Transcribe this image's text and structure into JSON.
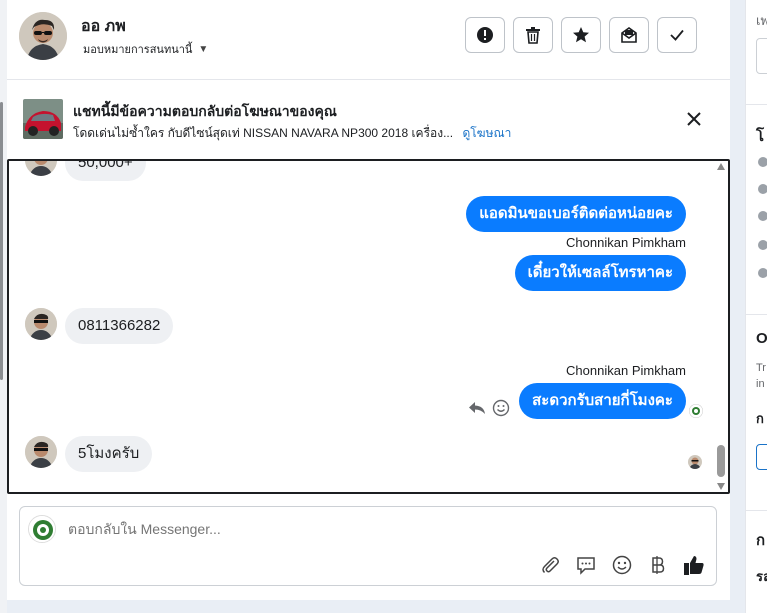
{
  "header": {
    "user_name": "ออ ภพ",
    "assign_label": "มอบหมายการสนทนานี้",
    "actions": [
      {
        "name": "mark-spam-button",
        "icon": "exclamation-circle-icon"
      },
      {
        "name": "delete-button",
        "icon": "trash-icon"
      },
      {
        "name": "star-button",
        "icon": "star-icon"
      },
      {
        "name": "mark-unread-button",
        "icon": "envelope-icon"
      },
      {
        "name": "mark-done-button",
        "icon": "check-icon"
      }
    ]
  },
  "ad_banner": {
    "title": "แชทนี้มีข้อความตอบกลับต่อโฆษณาของคุณ",
    "subtitle": "โดดเด่นไม่ซ้ำใคร กับดีไซน์สุดเท่ NISSAN NAVARA NP300 2018 เครื่อง...",
    "link": "ดูโฆษณา"
  },
  "messages": [
    {
      "direction": "in",
      "text": "50,000+"
    },
    {
      "direction": "out",
      "text": "แอดมินขอเบอร์ติดต่อหน่อยคะ"
    },
    {
      "direction": "out",
      "sender": "Chonnikan Pimkham",
      "text": "เดี๋ยวให้เซลล์โทรหาคะ"
    },
    {
      "direction": "in",
      "text": "0811366282"
    },
    {
      "direction": "out",
      "sender": "Chonnikan Pimkham",
      "text": "สะดวกรับสายกี่โมงคะ"
    },
    {
      "direction": "in",
      "text": "5โมงครับ"
    }
  ],
  "composer": {
    "placeholder": "ตอบกลับใน Messenger...",
    "tools": [
      "paperclip-icon",
      "saved-reply-icon",
      "emoji-icon",
      "baht-icon",
      "thumbs-up-icon"
    ]
  },
  "sidebar": {
    "fragments": [
      "เพ",
      "โ",
      "O",
      "Tr",
      "in",
      "ก",
      "ก",
      "รล"
    ]
  },
  "colors": {
    "accent": "#0a7cff",
    "incoming_bubble": "#eef0f3",
    "link": "#1a73c8"
  }
}
